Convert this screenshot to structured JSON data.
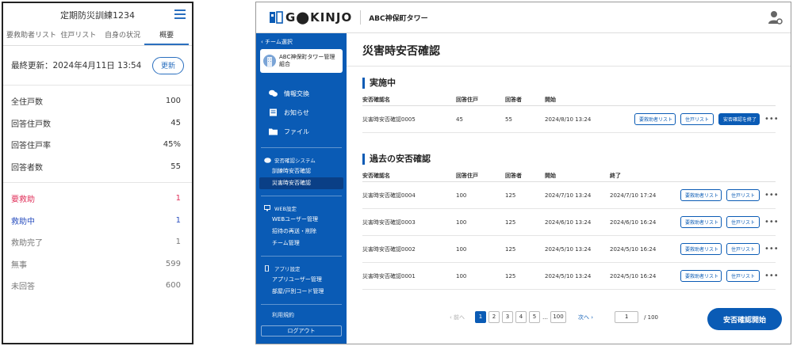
{
  "mobile": {
    "title": "定期防災訓練1234",
    "tabs": [
      "要救助者リスト",
      "住戸リスト",
      "自身の状況",
      "概要"
    ],
    "last_updated": "最終更新：2024年4月11日 13:54",
    "update_button": "更新",
    "stats": [
      {
        "label": "全住戸数",
        "value": "100"
      },
      {
        "label": "回答住戸数",
        "value": "45"
      },
      {
        "label": "回答住戸率",
        "value": "45%"
      },
      {
        "label": "回答者数",
        "value": "55"
      }
    ],
    "status": [
      {
        "label": "要救助",
        "value": "1",
        "tone": "red"
      },
      {
        "label": "救助中",
        "value": "1",
        "tone": "blue"
      },
      {
        "label": "救助完了",
        "value": "1",
        "tone": "gray"
      },
      {
        "label": "無事",
        "value": "599",
        "tone": "gray"
      },
      {
        "label": "未回答",
        "value": "600",
        "tone": "gray"
      }
    ],
    "colors": {
      "accent": "#2a6fbf",
      "red": "#e0305a",
      "blue": "#2a4fbf"
    }
  },
  "desktop": {
    "logo": "G⬤KINJO",
    "building": "ABC神保町タワー",
    "sidebar": {
      "back": "‹ チーム選択",
      "team_name": "ABC神保町タワー管理組合",
      "main_items": [
        "情報交換",
        "お知らせ",
        "ファイル"
      ],
      "groups": [
        {
          "label": "安否確認システム",
          "items": [
            "訓練時安否確認",
            "災害時安否確認"
          ]
        },
        {
          "label": "WEB設定",
          "items": [
            "WEBユーザー管理",
            "招待の再送・削除",
            "チーム管理"
          ]
        },
        {
          "label": "アプリ設定",
          "items": [
            "アプリユーザー管理",
            "部屋/戸別コード管理"
          ]
        }
      ],
      "terms": "利用規約",
      "logout": "ログアウト"
    },
    "page_title": "災害時安否確認",
    "active_section": {
      "title": "実施中",
      "headers": [
        "安否確認名",
        "回答住戸",
        "回答者",
        "開始"
      ],
      "rows": [
        {
          "name": "災害時安否確認0005",
          "resp": "45",
          "ans": "55",
          "start": "2024/8/10 13:24"
        }
      ],
      "buttons": [
        "要救助者リスト",
        "住戸リスト",
        "安否確認を終了"
      ]
    },
    "past_section": {
      "title": "過去の安否確認",
      "headers": [
        "安否確認名",
        "回答住戸",
        "回答者",
        "開始",
        "終了"
      ],
      "rows": [
        {
          "name": "災害時安否確認0004",
          "resp": "100",
          "ans": "125",
          "start": "2024/7/10 13:24",
          "end": "2024/7/10 17:24"
        },
        {
          "name": "災害時安否確認0003",
          "resp": "100",
          "ans": "125",
          "start": "2024/6/10 13:24",
          "end": "2024/6/10 16:24"
        },
        {
          "name": "災害時安否確認0002",
          "resp": "100",
          "ans": "125",
          "start": "2024/5/10 13:24",
          "end": "2024/5/10 16:24"
        },
        {
          "name": "災害時安否確認0001",
          "resp": "100",
          "ans": "125",
          "start": "2024/5/10 13:24",
          "end": "2024/5/10 16:24"
        }
      ],
      "buttons": [
        "要救助者リスト",
        "住戸リスト"
      ]
    },
    "more_label": "•••",
    "pager": {
      "prev": "‹ 前へ",
      "pages": [
        "1",
        "2",
        "3",
        "4",
        "5"
      ],
      "ellipsis": "…",
      "last": "100",
      "next": "次へ ›",
      "jump_value": "1",
      "total": "/ 100"
    },
    "start_button": "安否確認開始",
    "colors": {
      "primary": "#0a5bb5"
    }
  }
}
